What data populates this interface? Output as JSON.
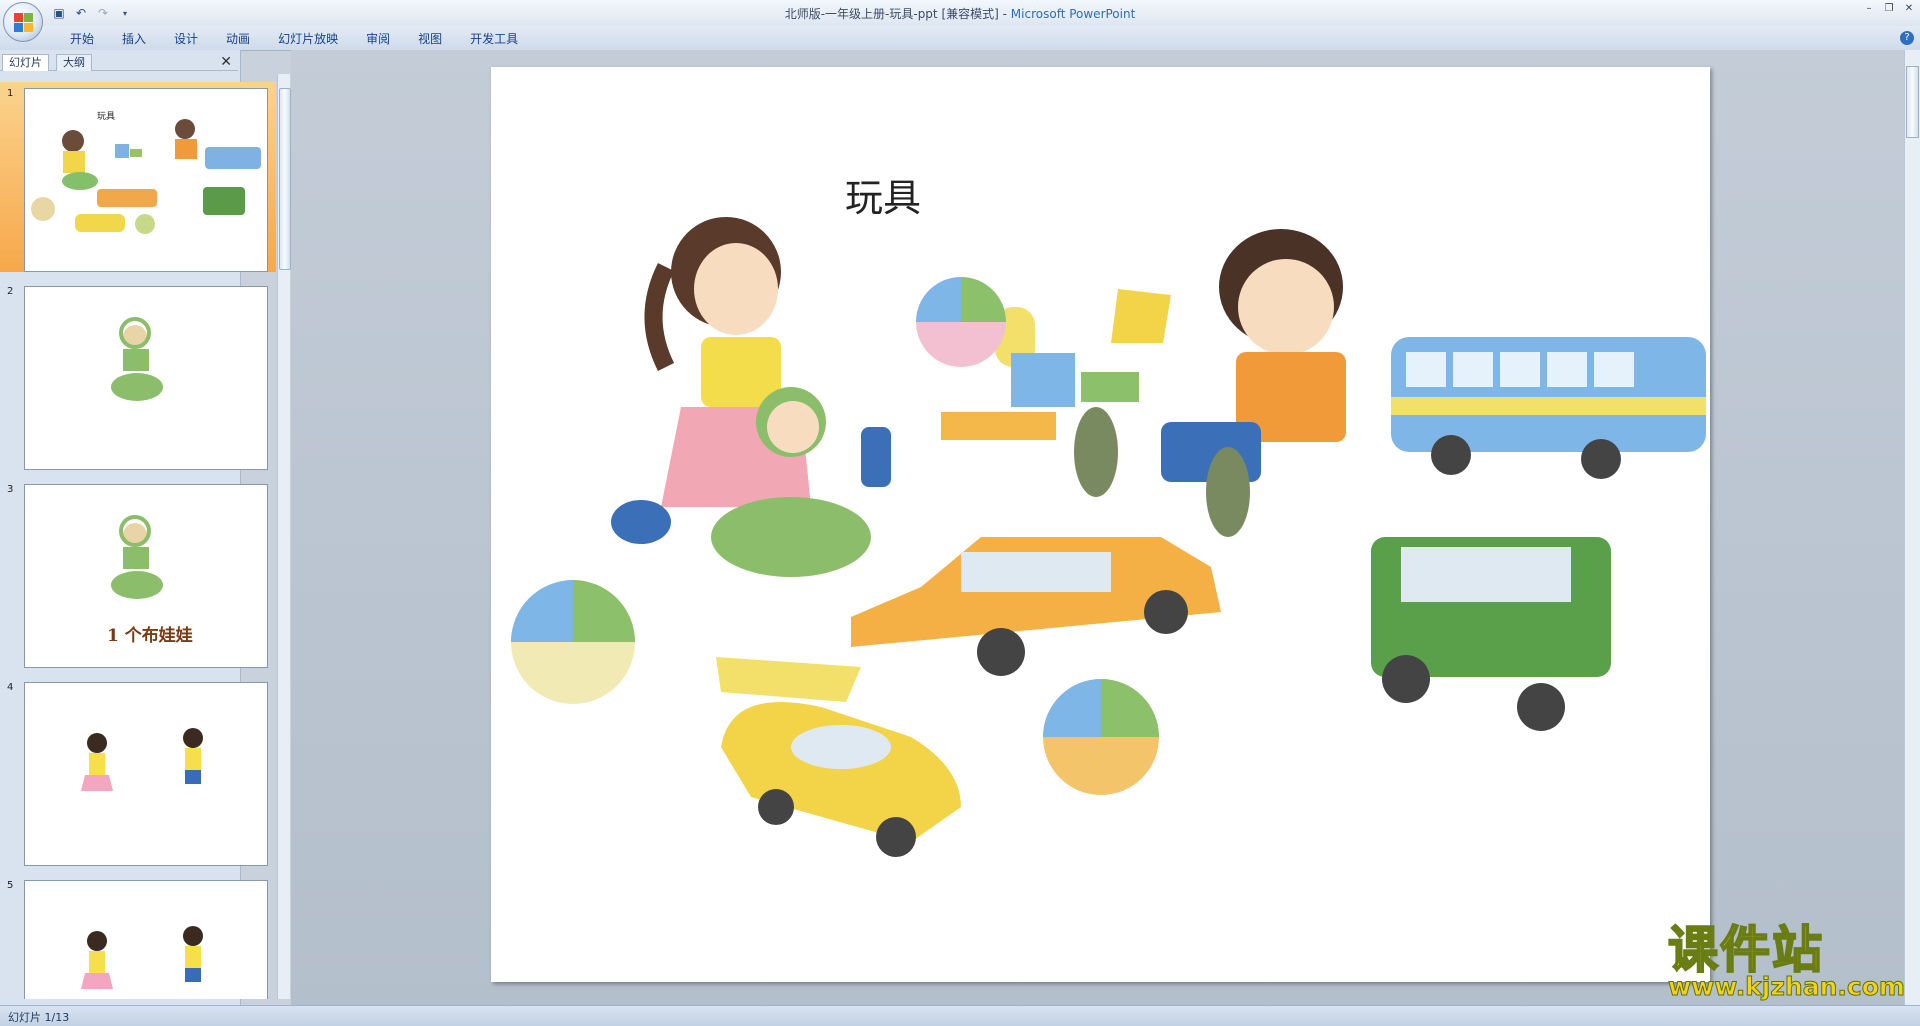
{
  "window": {
    "title": "北师版-一年级上册-玩具-ppt [兼容模式]",
    "app": "Microsoft PowerPoint"
  },
  "ribbon": {
    "tabs": [
      "开始",
      "插入",
      "设计",
      "动画",
      "幻灯片放映",
      "审阅",
      "视图",
      "开发工具"
    ]
  },
  "side_panel": {
    "tab_slides": "幻灯片",
    "tab_outline": "大纲",
    "slides": [
      {
        "number": "1",
        "title": "玩具"
      },
      {
        "number": "2"
      },
      {
        "number": "3",
        "caption": "1 个布娃娃"
      },
      {
        "number": "4"
      },
      {
        "number": "5"
      }
    ]
  },
  "slide": {
    "title": "玩具"
  },
  "status": {
    "text": "幻灯片 1/13"
  },
  "watermark": {
    "brand": "课件站",
    "url": "www.kjzhan.com"
  },
  "colors": {
    "ribbon_text": "#15428b",
    "selected_thumb": "#f6a84b",
    "watermark": "#f5d312"
  }
}
